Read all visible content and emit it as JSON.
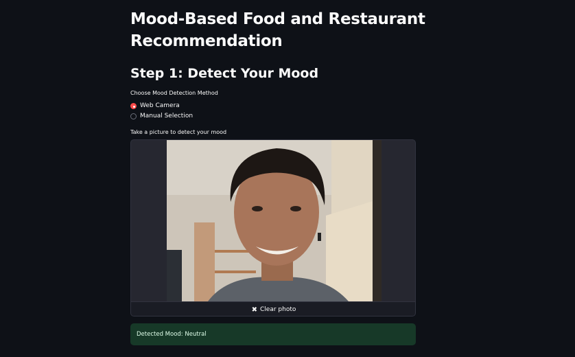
{
  "page": {
    "title": "Mood-Based Food and Restaurant Recommendation",
    "step_heading": "Step 1: Detect Your Mood"
  },
  "mood_method": {
    "label": "Choose Mood Detection Method",
    "options": [
      "Web Camera",
      "Manual Selection"
    ],
    "selected": "Web Camera"
  },
  "camera": {
    "label": "Take a picture to detect your mood",
    "photo_description": "webcam photo of a smiling person",
    "clear_label": "Clear photo",
    "clear_icon": "close-icon"
  },
  "result": {
    "text": "Detected Mood: Neutral"
  },
  "colors": {
    "background": "#0e1117",
    "accent": "#ff4b4b",
    "success_bg": "#173928"
  }
}
